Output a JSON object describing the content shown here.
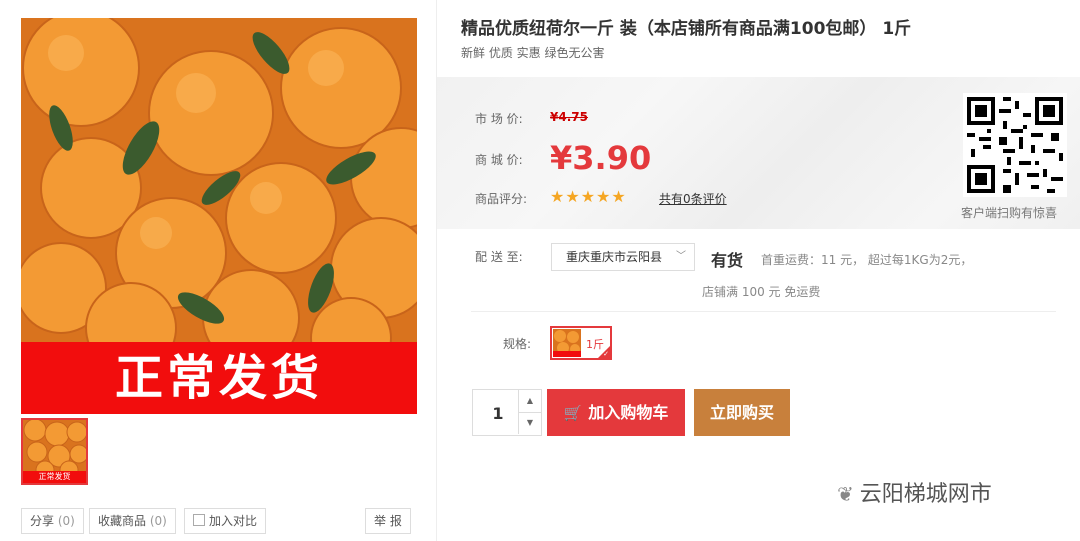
{
  "product": {
    "title": "精品优质纽荷尔一斤 装（本店铺所有商品满100包邮） 1斤",
    "subtitle": "新鲜 优质 实惠 绿色无公害",
    "image_banner_text": "正常发货",
    "thumb_banner_text": "正常发货"
  },
  "gallery_actions": {
    "share_label": "分享",
    "share_count": "(0)",
    "favorite_label": "收藏商品",
    "favorite_count": "(0)",
    "compare_label": "加入对比",
    "report_label": "举 报"
  },
  "price_box": {
    "market_label": "市 场 价:",
    "market_price": "¥4.75",
    "shop_label": "商 城 价:",
    "shop_price": "¥3.90",
    "rating_label": "商品评分:",
    "rating": 5,
    "review_link": "共有0条评价",
    "qr_caption": "客户端扫购有惊喜"
  },
  "shipping": {
    "label": "配 送 至:",
    "region": "重庆重庆市云阳县",
    "stock": "有货",
    "fee_line1": "首重运费：11 元，  超过每1KG为2元，",
    "fee_line2": "店铺满 100 元 免运费"
  },
  "spec": {
    "label": "规格:",
    "option": "1斤"
  },
  "purchase": {
    "quantity": "1",
    "add_to_cart": "加入购物车",
    "buy_now": "立即购买"
  },
  "watermark": "云阳梯城网市",
  "colors": {
    "accent_red": "#e4393c",
    "buy_button": "#c8803c",
    "star": "#f5a623",
    "banner_red": "#f20d0d"
  }
}
